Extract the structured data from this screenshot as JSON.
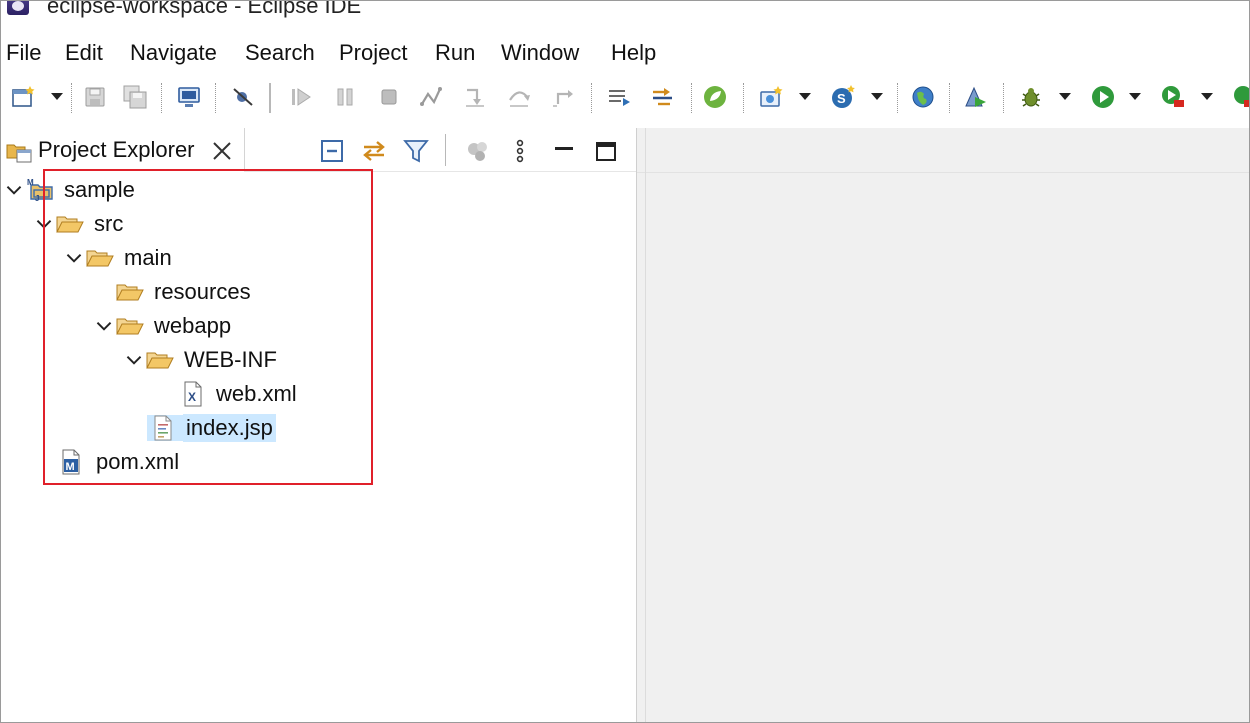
{
  "window": {
    "title": "eclipse-workspace - Eclipse IDE"
  },
  "menu": [
    "File",
    "Edit",
    "Navigate",
    "Search",
    "Project",
    "Run",
    "Window",
    "Help"
  ],
  "toolbar_icons": [
    "new-wizard-icon",
    "save-icon",
    "save-all-icon",
    "terminal-icon",
    "skip-breakpoints-icon",
    "resume-icon",
    "suspend-icon",
    "terminate-icon",
    "disconnect-icon",
    "step-into-icon",
    "step-over-icon",
    "step-return-icon",
    "drop-to-frame-icon",
    "use-step-filters-icon",
    "spring-icon",
    "new-server-icon",
    "new-spring-starter-icon",
    "globe-icon",
    "launch-icon",
    "debug-icon",
    "run-icon",
    "coverage-icon"
  ],
  "project_explorer": {
    "tab_label": "Project Explorer",
    "tree": [
      {
        "label": "sample",
        "icon": "maven-project-icon",
        "expanded": true
      },
      {
        "label": "src",
        "icon": "folder-open-icon",
        "expanded": true
      },
      {
        "label": "main",
        "icon": "folder-open-icon",
        "expanded": true
      },
      {
        "label": "resources",
        "icon": "folder-open-icon"
      },
      {
        "label": "webapp",
        "icon": "folder-open-icon",
        "expanded": true
      },
      {
        "label": "WEB-INF",
        "icon": "folder-open-icon",
        "expanded": true
      },
      {
        "label": "web.xml",
        "icon": "xml-file-icon"
      },
      {
        "label": "index.jsp",
        "icon": "jsp-file-icon",
        "selected": true
      },
      {
        "label": "pom.xml",
        "icon": "maven-pom-icon"
      }
    ]
  },
  "colors": {
    "highlight_box": "#e0202a",
    "selection": "#cce8ff",
    "editor_background": "#f0f0f0",
    "folder": "#e8b64c"
  }
}
